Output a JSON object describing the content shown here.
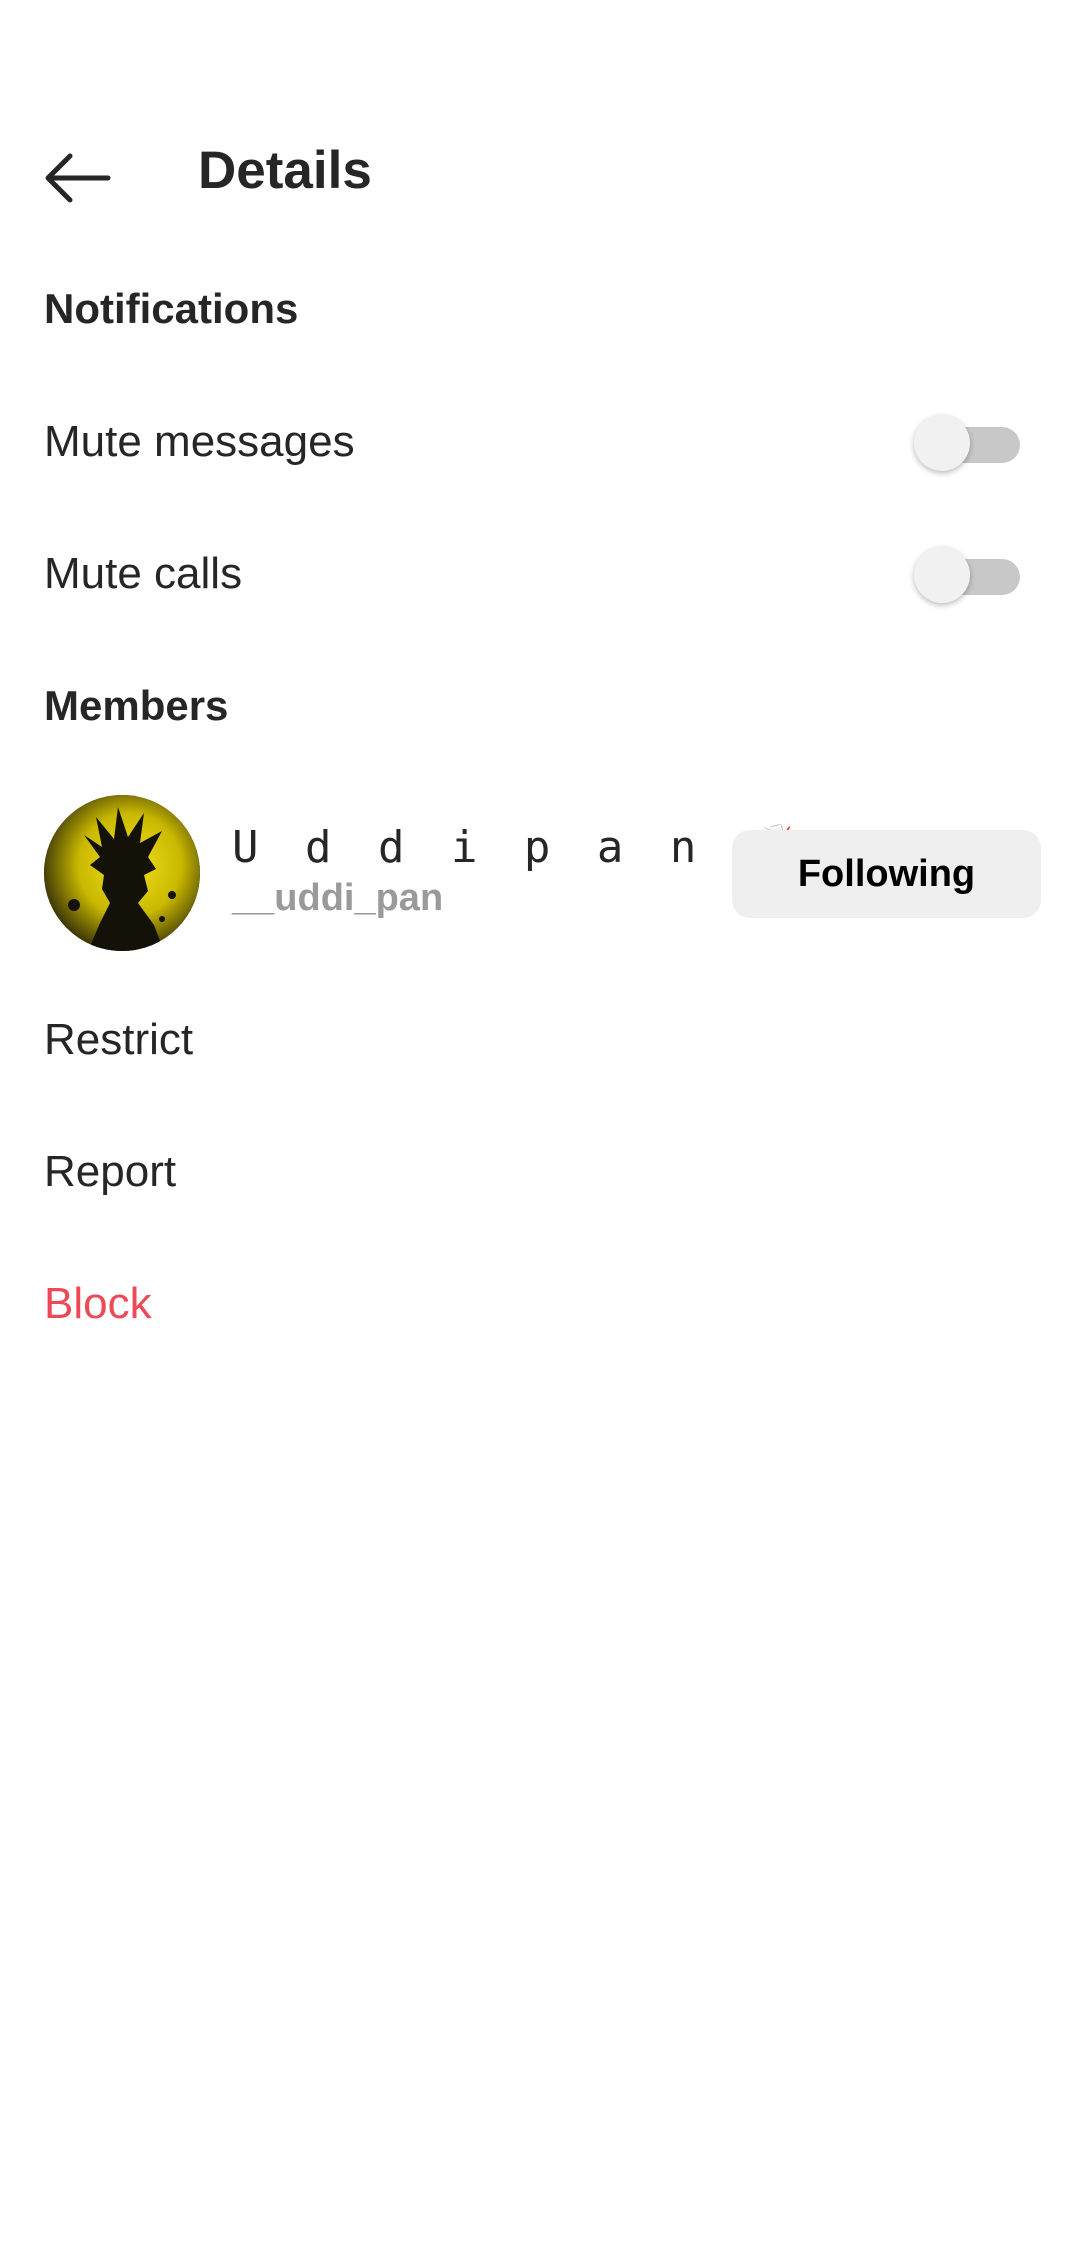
{
  "header": {
    "title": "Details",
    "back_icon": "arrow-left-icon"
  },
  "notifications": {
    "section_title": "Notifications",
    "mute_messages": {
      "label": "Mute messages",
      "enabled": false
    },
    "mute_calls": {
      "label": "Mute calls",
      "enabled": false
    }
  },
  "members": {
    "section_title": "Members",
    "items": [
      {
        "display_name": "U d d i p a n 🥂",
        "username": "__uddi_pan",
        "button_label": "Following",
        "avatar_icon": "profile-avatar"
      }
    ]
  },
  "actions": {
    "restrict": "Restrict",
    "report": "Report",
    "block": "Block"
  },
  "colors": {
    "danger": "#ed4956",
    "button_bg": "#efefef",
    "muted_text": "#9a9a9a"
  }
}
